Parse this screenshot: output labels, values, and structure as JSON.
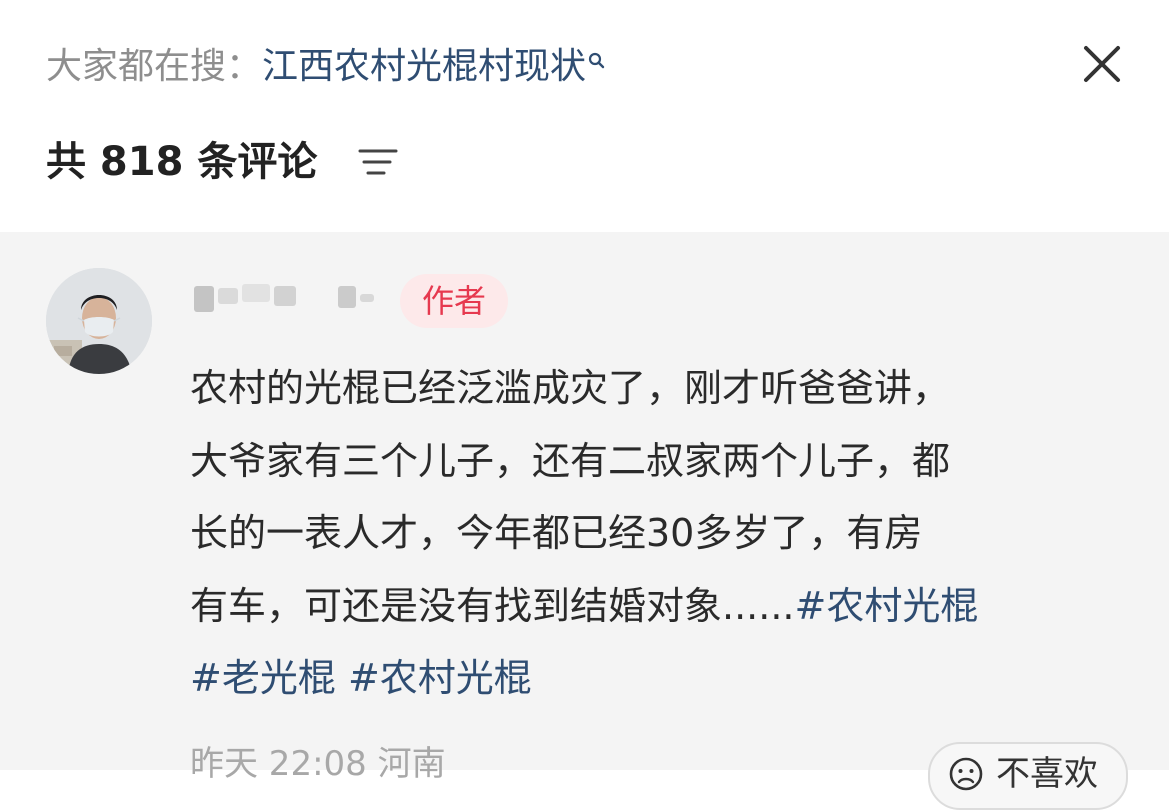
{
  "header": {
    "search_prefix": "大家都在搜：",
    "search_query": "江西农村光棍村现状",
    "comment_count_label": "共 818 条评论"
  },
  "comment": {
    "badge": "作者",
    "lines": [
      [
        {
          "t": "农村的光棍已经泛滥成灾了，刚才听爸爸讲，",
          "tag": false
        }
      ],
      [
        {
          "t": "大爷家有三个儿子，还有二叔家两个儿子，都",
          "tag": false
        }
      ],
      [
        {
          "t": "长的一表人才，今年都已经30多岁了，有房",
          "tag": false
        }
      ],
      [
        {
          "t": "有车，可还是没有找到结婚对象......",
          "tag": false
        },
        {
          "t": "#农村光棍",
          "tag": true
        }
      ],
      [
        {
          "t": "#老光棍",
          "tag": true
        },
        {
          "t": " ",
          "tag": false
        },
        {
          "t": "#农村光棍",
          "tag": true
        }
      ]
    ],
    "meta": "昨天 22:08 河南",
    "dislike_label": "不喜欢"
  },
  "icons": {
    "close": "close-icon",
    "sort": "sort-filter-icon",
    "search": "search-icon",
    "dislike": "dislike-face-icon"
  },
  "colors": {
    "link": "#2f4d72",
    "badge_text": "#e6394f",
    "badge_bg": "#fde9ea",
    "comment_bg": "#f4f4f4"
  }
}
